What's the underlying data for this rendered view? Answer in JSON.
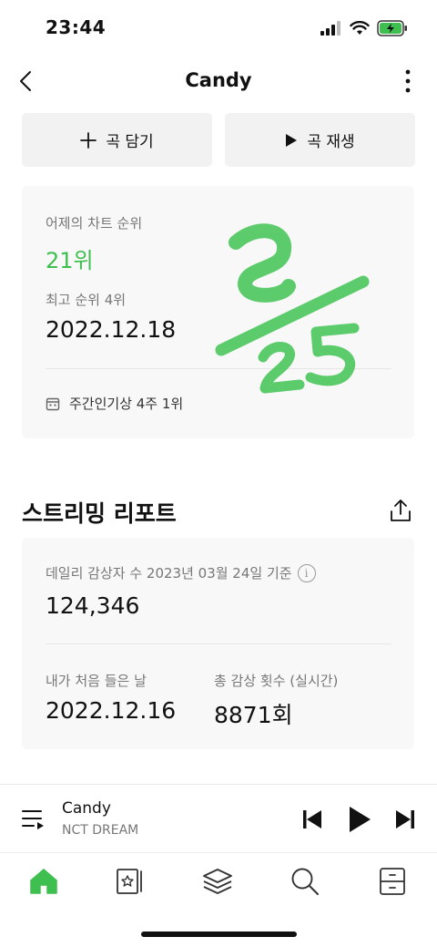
{
  "status_bar": {
    "time": "23:44"
  },
  "header": {
    "title": "Candy"
  },
  "actions": {
    "add_label": "곡 담기",
    "play_label": "곡 재생"
  },
  "chart": {
    "yesterday_label": "어제의 차트 순위",
    "yesterday_rank": "21위",
    "best_label": "최고 순위 4위",
    "best_date": "2022.12.18",
    "weekly_text": "주간인기상 4주 1위",
    "accent_color": "#3ebf4f"
  },
  "report": {
    "title": "스트리밍 리포트",
    "daily_label": "데일리 감상자 수 2023년 03월 24일 기준",
    "daily_value": "124,346",
    "first_listen_label": "내가 처음 들은 날",
    "first_listen_value": "2022.12.16",
    "total_label": "총 감상 횟수 (실시간)",
    "total_value": "8871회"
  },
  "player": {
    "track": "Candy",
    "artist": "NCT DREAM"
  },
  "tabs": [
    "home-icon",
    "library-icon",
    "layers-icon",
    "search-icon",
    "storage-icon"
  ],
  "icons": {
    "info": "i"
  }
}
